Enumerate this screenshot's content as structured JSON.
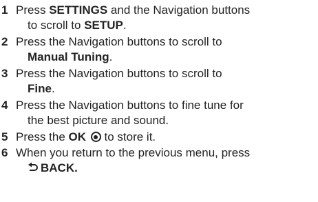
{
  "steps": [
    {
      "number": "1",
      "line1": [
        "Press ",
        "SETTINGS",
        " and the Navigation buttons"
      ],
      "line2": [
        "to scroll to ",
        "SETUP",
        "."
      ]
    },
    {
      "number": "2",
      "line1": [
        "Press the Navigation buttons to scroll to"
      ],
      "line2": [
        "Manual Tuning",
        "."
      ]
    },
    {
      "number": "3",
      "line1": [
        "Press the Navigation buttons to scroll to"
      ],
      "line2": [
        "Fine",
        "."
      ]
    },
    {
      "number": "4",
      "line1": [
        "Press the Navigation buttons to fine tune for"
      ],
      "line2": [
        "the best picture and sound."
      ]
    },
    {
      "number": "5",
      "line1": [
        "Press the ",
        "OK",
        " to store it."
      ],
      "ok_icon": "ok-button-icon"
    },
    {
      "number": "6",
      "line1": [
        "When you return to the previous menu, press"
      ],
      "line2": [
        "BACK."
      ],
      "back_icon": "back-arrow-icon"
    }
  ]
}
